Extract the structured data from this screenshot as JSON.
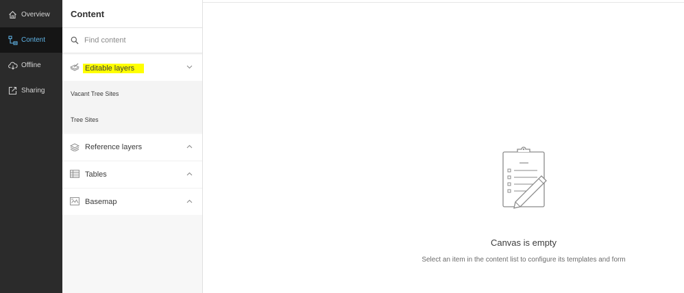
{
  "nav": {
    "items": [
      {
        "label": "Overview",
        "icon": "home-icon"
      },
      {
        "label": "Content",
        "icon": "content-tree-icon"
      },
      {
        "label": "Offline",
        "icon": "cloud-offline-icon"
      },
      {
        "label": "Sharing",
        "icon": "share-icon"
      }
    ],
    "active": "Content",
    "active_color": "#5fb3e6"
  },
  "panel": {
    "title": "Content",
    "search_placeholder": "Find content",
    "sections": [
      {
        "label": "Editable layers",
        "expanded": true,
        "highlighted": true,
        "highlight_color": "#ffff00",
        "items": [
          "Vacant Tree Sites",
          "Tree Sites"
        ]
      },
      {
        "label": "Reference layers",
        "expanded": false
      },
      {
        "label": "Tables",
        "expanded": false
      },
      {
        "label": "Basemap",
        "expanded": false
      }
    ]
  },
  "canvas": {
    "empty_title": "Canvas is empty",
    "empty_subtitle": "Select an item in the content list to configure its templates and form"
  }
}
